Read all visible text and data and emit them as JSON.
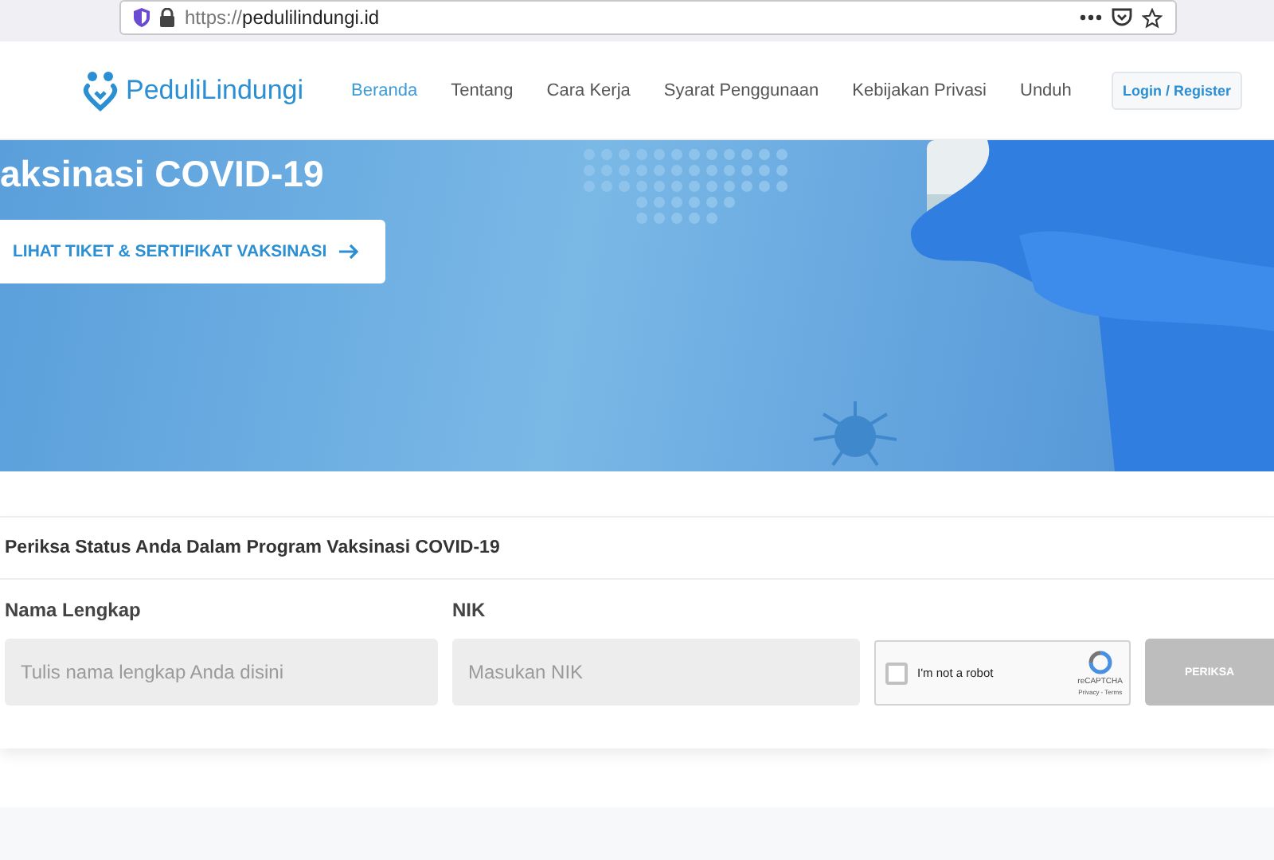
{
  "browser": {
    "url_scheme": "https://",
    "url_host": "pedulilindungi.id"
  },
  "header": {
    "logo": "PeduliLindungi",
    "nav": [
      {
        "label": "Beranda",
        "selected": true
      },
      {
        "label": "Tentang",
        "selected": false
      },
      {
        "label": "Cara Kerja",
        "selected": false
      },
      {
        "label": "Syarat Penggunaan",
        "selected": false
      },
      {
        "label": "Kebijakan Privasi",
        "selected": false
      },
      {
        "label": "Unduh",
        "selected": false
      }
    ],
    "login": "Login / Register"
  },
  "hero": {
    "title": "aksinasi COVID-19",
    "button": "LIHAT TIKET & SERTIFIKAT VAKSINASI"
  },
  "check": {
    "title": "Periksa Status Anda Dalam Program Vaksinasi COVID-19",
    "fields": [
      {
        "label": "Nama Lengkap",
        "placeholder": "Tulis nama lengkap Anda disini"
      },
      {
        "label": "NIK",
        "placeholder": "Masukan NIK"
      }
    ],
    "captcha": {
      "label": "I'm not a robot",
      "checked": false,
      "brand": "reCAPTCHA",
      "links": "Privacy - Terms"
    },
    "submit": {
      "label": "PERIKSA",
      "disabled": true
    }
  }
}
